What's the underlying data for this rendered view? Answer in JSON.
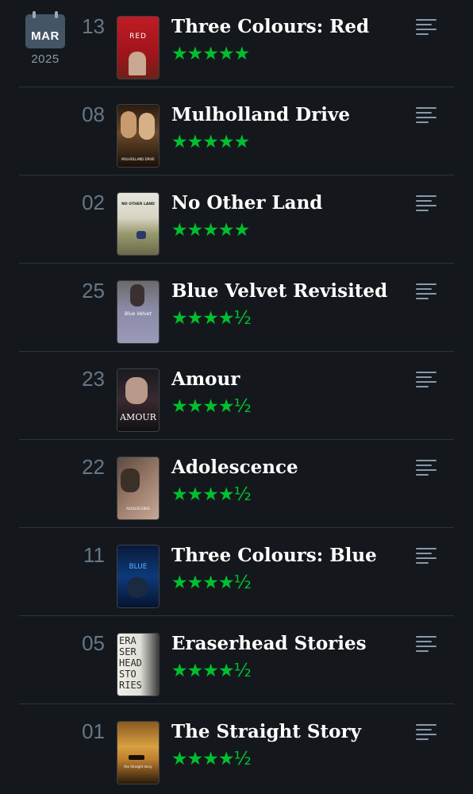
{
  "diary": {
    "month": "MAR",
    "year": "2025",
    "entries": [
      {
        "day": "13",
        "title": "Three Colours: Red",
        "rating": "★★★★★",
        "poster_text": "RED",
        "poster_bg": "#b3202a"
      },
      {
        "day": "08",
        "title": "Mulholland Drive",
        "rating": "★★★★★",
        "poster_text": "MULHOLLAND DRIVE",
        "poster_bg": "#3a2a1a"
      },
      {
        "day": "02",
        "title": "No Other Land",
        "rating": "★★★★★",
        "poster_text": "NO OTHER LAND",
        "poster_bg": "#d8d6cc"
      },
      {
        "day": "25",
        "title": "Blue Velvet Revisited",
        "rating": "★★★★½",
        "poster_text": "Blue Velvet",
        "poster_bg": "#8a8aa8"
      },
      {
        "day": "23",
        "title": "Amour",
        "rating": "★★★★½",
        "poster_text": "AMOUR",
        "poster_bg": "#1a1a20"
      },
      {
        "day": "22",
        "title": "Adolescence",
        "rating": "★★★★½",
        "poster_text": "ADOLESCENCE",
        "poster_bg": "#9a7a68"
      },
      {
        "day": "11",
        "title": "Three Colours: Blue",
        "rating": "★★★★½",
        "poster_text": "BLUE",
        "poster_bg": "#0d2a55"
      },
      {
        "day": "05",
        "title": "Eraserhead Stories",
        "rating": "★★★★½",
        "poster_text": "ERA SER HEAD STO RIES",
        "poster_bg": "#e8e8e0"
      },
      {
        "day": "01",
        "title": "The Straight Story",
        "rating": "★★★★½",
        "poster_text": "the Straight story",
        "poster_bg": "#c08a30"
      }
    ]
  },
  "colors": {
    "background": "#14181c",
    "star_green": "#00c030",
    "divider": "#2c3440"
  },
  "icons": {
    "calendar": "calendar-icon",
    "review": "review-lines-icon"
  }
}
